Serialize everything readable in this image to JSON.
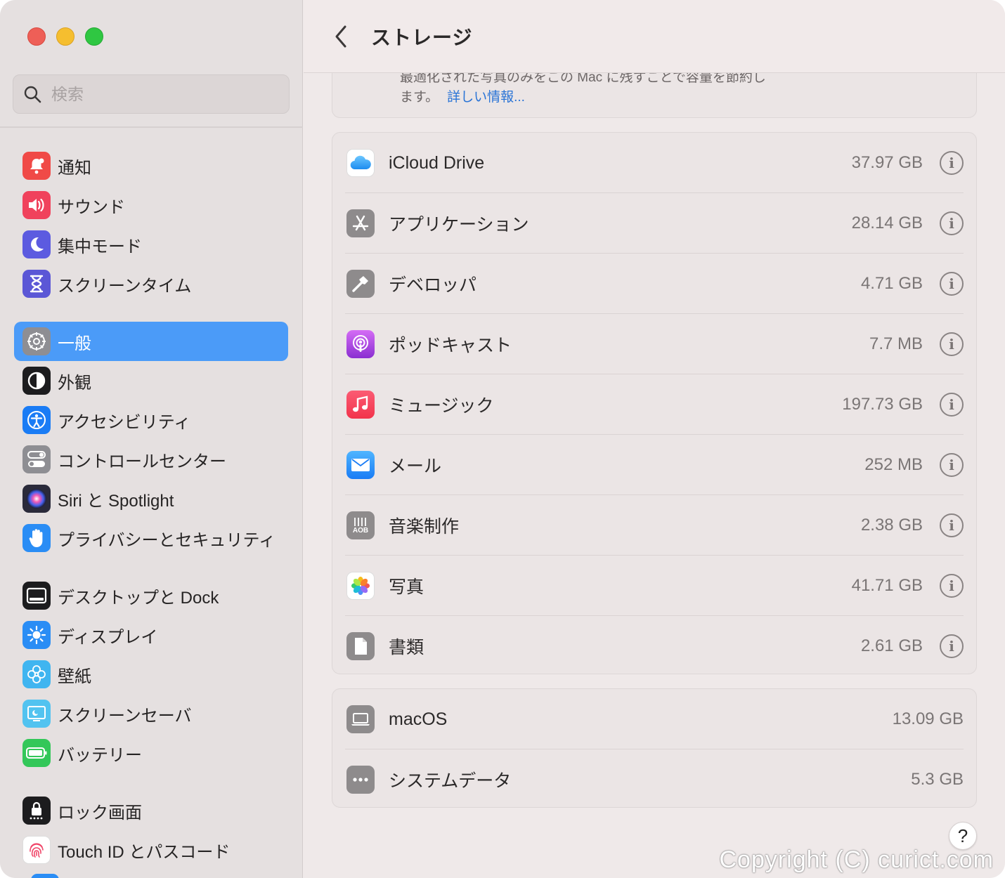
{
  "sidebar": {
    "search_placeholder": "検索",
    "items": [
      {
        "label": "通知",
        "icon": "bell-icon",
        "color": "#f04a47"
      },
      {
        "label": "サウンド",
        "icon": "speaker-icon",
        "color": "#f0425c"
      },
      {
        "label": "集中モード",
        "icon": "moon-icon",
        "color": "#5c5be0"
      },
      {
        "label": "スクリーンタイム",
        "icon": "hourglass-icon",
        "color": "#5b57d6"
      },
      {
        "label": "一般",
        "icon": "gear-icon",
        "color": "#8e8e93",
        "active": true
      },
      {
        "label": "外観",
        "icon": "appearance-icon",
        "color": "#1c1c1e"
      },
      {
        "label": "アクセシビリティ",
        "icon": "accessibility-icon",
        "color": "#1a7cf5"
      },
      {
        "label": "コントロールセンター",
        "icon": "toggles-icon",
        "color": "#8e8e93"
      },
      {
        "label": "Siri と Spotlight",
        "icon": "siri-icon",
        "color": "#2a2a3a"
      },
      {
        "label": "プライバシーとセキュリティ",
        "icon": "hand-icon",
        "color": "#2a8df5"
      },
      {
        "label": "デスクトップと Dock",
        "icon": "dock-icon",
        "color": "#1c1c1e"
      },
      {
        "label": "ディスプレイ",
        "icon": "sun-icon",
        "color": "#2a8df5"
      },
      {
        "label": "壁紙",
        "icon": "flower-icon",
        "color": "#40b5f0"
      },
      {
        "label": "スクリーンセーバ",
        "icon": "screensaver-icon",
        "color": "#52c3f0"
      },
      {
        "label": "バッテリー",
        "icon": "battery-icon",
        "color": "#33c759"
      },
      {
        "label": "ロック画面",
        "icon": "lock-icon",
        "color": "#1c1c1e"
      },
      {
        "label": "Touch ID とパスコード",
        "icon": "fingerprint-icon",
        "color": "#ffffff"
      }
    ]
  },
  "header": {
    "title": "ストレージ"
  },
  "tip": {
    "line1": "最適化された写真のみをこの Mac に残すことで容量を節約し",
    "line2": "ます。",
    "link": "詳しい情報..."
  },
  "storage_items": [
    {
      "label": "iCloud Drive",
      "size": "37.97 GB",
      "icon": "icloud-icon"
    },
    {
      "label": "アプリケーション",
      "size": "28.14 GB",
      "icon": "app-store-icon"
    },
    {
      "label": "デベロッパ",
      "size": "4.71 GB",
      "icon": "hammer-icon"
    },
    {
      "label": "ポッドキャスト",
      "size": "7.7 MB",
      "icon": "podcast-icon"
    },
    {
      "label": "ミュージック",
      "size": "197.73 GB",
      "icon": "music-icon"
    },
    {
      "label": "メール",
      "size": "252 MB",
      "icon": "mail-icon"
    },
    {
      "label": "音楽制作",
      "size": "2.38 GB",
      "icon": "music-creation-icon"
    },
    {
      "label": "写真",
      "size": "41.71 GB",
      "icon": "photos-icon"
    },
    {
      "label": "書類",
      "size": "2.61 GB",
      "icon": "document-icon"
    }
  ],
  "system_items": [
    {
      "label": "macOS",
      "size": "13.09 GB",
      "icon": "laptop-icon"
    },
    {
      "label": "システムデータ",
      "size": "5.3 GB",
      "icon": "ellipsis-icon"
    }
  ],
  "help_label": "?",
  "watermark": "Copyright (C) curict.com"
}
